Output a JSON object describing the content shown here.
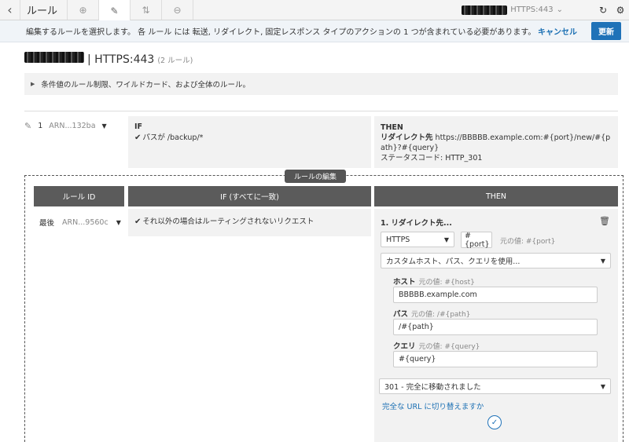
{
  "toolbar": {
    "title": "ルール",
    "listener": "HTTPS:443"
  },
  "banner": {
    "instruction": "編集するルールを選択します。 各 ルール には 転送, リダイレクト, 固定レスポンス タイプのアクションの 1 つが含まれている必要があります。",
    "cancel_label": "キャンセル",
    "update_label": "更新"
  },
  "listener": {
    "name": "| HTTPS:443",
    "rule_count": "(2 ルール)",
    "info": "条件値のルール制限、ワイルドカード、および全体のルール。"
  },
  "rule1": {
    "number": "1",
    "arn": "ARN...132ba",
    "if_head": "IF",
    "condition": "パスが /backup/*",
    "then_head": "THEN",
    "redirect_label": "リダイレクト先",
    "redirect_target": "https://BBBBB.example.com:#{port}/new/#{path}?#{query}",
    "status": "ステータスコード: HTTP_301"
  },
  "edit": {
    "label": "ルールの編集",
    "columns": [
      "ルール ID",
      "IF (すべてに一致)",
      "THEN"
    ],
    "rule_position": "最後",
    "arn": "ARN...9560c",
    "condition": "それ以外の場合はルーティングされないリクエスト",
    "action_title": "1. リダイレクト先...",
    "protocol": "HTTPS",
    "port_value": "#{port}",
    "port_hint": "元の値: #{port}",
    "mode": "カスタムホスト、パス、クエリを使用...",
    "host_label": "ホスト",
    "host_hint": "元の値: #{host}",
    "host_value": "BBBBB.example.com",
    "path_label": "パス",
    "path_hint": "元の値: /#{path}",
    "path_value": "/#{path}",
    "query_label": "クエリ",
    "query_hint": "元の値: #{query}",
    "query_value": "#{query}",
    "status_code": "301 - 完全に移動されました",
    "switch_link": "完全な URL に切り替えますか"
  }
}
